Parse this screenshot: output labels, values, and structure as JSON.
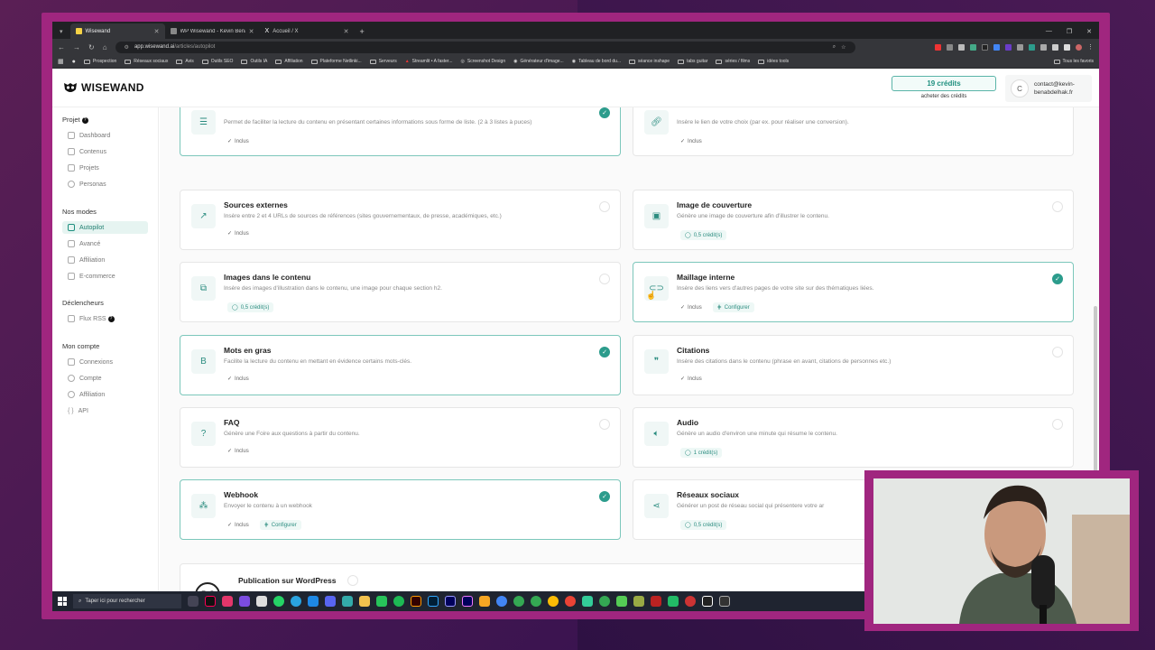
{
  "browser": {
    "tabs": [
      {
        "title": "Wisewand",
        "active": true
      },
      {
        "title": "WP Wisewand - Kevin Benabdelhak",
        "active": false
      },
      {
        "title": "Accueil / X",
        "active": false
      }
    ],
    "url_host": "app.wisewand.ai",
    "url_path": "/articles/autopilot",
    "bookmarks": [
      "Prospection",
      "Réseaux sociaux",
      "Avis",
      "Outils SEO",
      "Outils IA",
      "Affiliation",
      "Plateforme Netlinki...",
      "Serveurs",
      "Streamlit • A faster...",
      "Screenshot Design",
      "Générateur d'image...",
      "Tableau de bord du...",
      "séance inshape",
      "tabs guitar",
      "séries / films",
      "idées tools"
    ],
    "bookmarks_right": "Tous les favoris"
  },
  "header": {
    "logo": "WISEWAND",
    "credits": "19 crédits",
    "buy_credits": "acheter des crédits",
    "avatar_letter": "C",
    "user_email_1": "contact@kevin-",
    "user_email_2": "benabdelhak.fr"
  },
  "sidebar": {
    "section_project": "Projet",
    "project_items": [
      "Dashboard",
      "Contenus",
      "Projets",
      "Personas"
    ],
    "section_modes": "Nos modes",
    "mode_items": [
      "Autopilot",
      "Avancé",
      "Affiliation",
      "E-commerce"
    ],
    "section_triggers": "Déclencheurs",
    "trigger_items": [
      "Flux RSS"
    ],
    "section_account": "Mon compte",
    "account_items": [
      "Connexions",
      "Compte",
      "Affiliation",
      "API"
    ]
  },
  "cards": {
    "list": {
      "desc": "Permet de faciliter la lecture du contenu en présentant certaines informations sous forme de liste. (2 à 3 listes à puces)",
      "tag": "Inclus"
    },
    "link": {
      "desc": "Insère le lien de votre choix (par ex. pour réaliser une conversion).",
      "tag": "Inclus"
    },
    "sources": {
      "title": "Sources externes",
      "desc": "Insère entre 2 et 4 URLs de sources de références (sites gouvernementaux, de presse, académiques, etc.)",
      "tag": "Inclus"
    },
    "cover": {
      "title": "Image de couverture",
      "desc": "Génère une image de couverture afin d'illustrer le contenu.",
      "credit": "0,5 crédit(s)"
    },
    "images": {
      "title": "Images dans le contenu",
      "desc": "Insère des images d'illustration dans le contenu, une image pour chaque section h2.",
      "credit": "0,5 crédit(s)"
    },
    "internal": {
      "title": "Maillage interne",
      "desc": "Insère des liens vers d'autres pages de votre site sur des thématiques liées.",
      "tag": "Inclus",
      "config": "Configurer"
    },
    "bold": {
      "title": "Mots en gras",
      "desc": "Facilite la lecture du contenu en mettant en évidence certains mots-clés.",
      "tag": "Inclus"
    },
    "quotes": {
      "title": "Citations",
      "desc": "Insère des citations dans le contenu (phrase en avant, citations de personnes etc.)",
      "tag": "Inclus"
    },
    "faq": {
      "title": "FAQ",
      "desc": "Génère une Foire aux questions à partir du contenu.",
      "tag": "Inclus"
    },
    "audio": {
      "title": "Audio",
      "desc": "Génère un audio d'environ une minute qui résume le contenu.",
      "credit": "1 crédit(s)"
    },
    "webhook": {
      "title": "Webhook",
      "desc": "Envoyer le contenu à un webhook",
      "tag": "Inclus",
      "config": "Configurer"
    },
    "social": {
      "title": "Réseaux sociaux",
      "desc": "Générer un post de réseau social qui présentere votre ar",
      "credit": "0,5 crédit(s)"
    },
    "wordpress": {
      "title": "Publication sur WordPress"
    }
  },
  "taskbar": {
    "search_placeholder": "Taper ici pour rechercher"
  },
  "colors": {
    "accent": "#2c9c8c",
    "frame": "#a0267f"
  }
}
